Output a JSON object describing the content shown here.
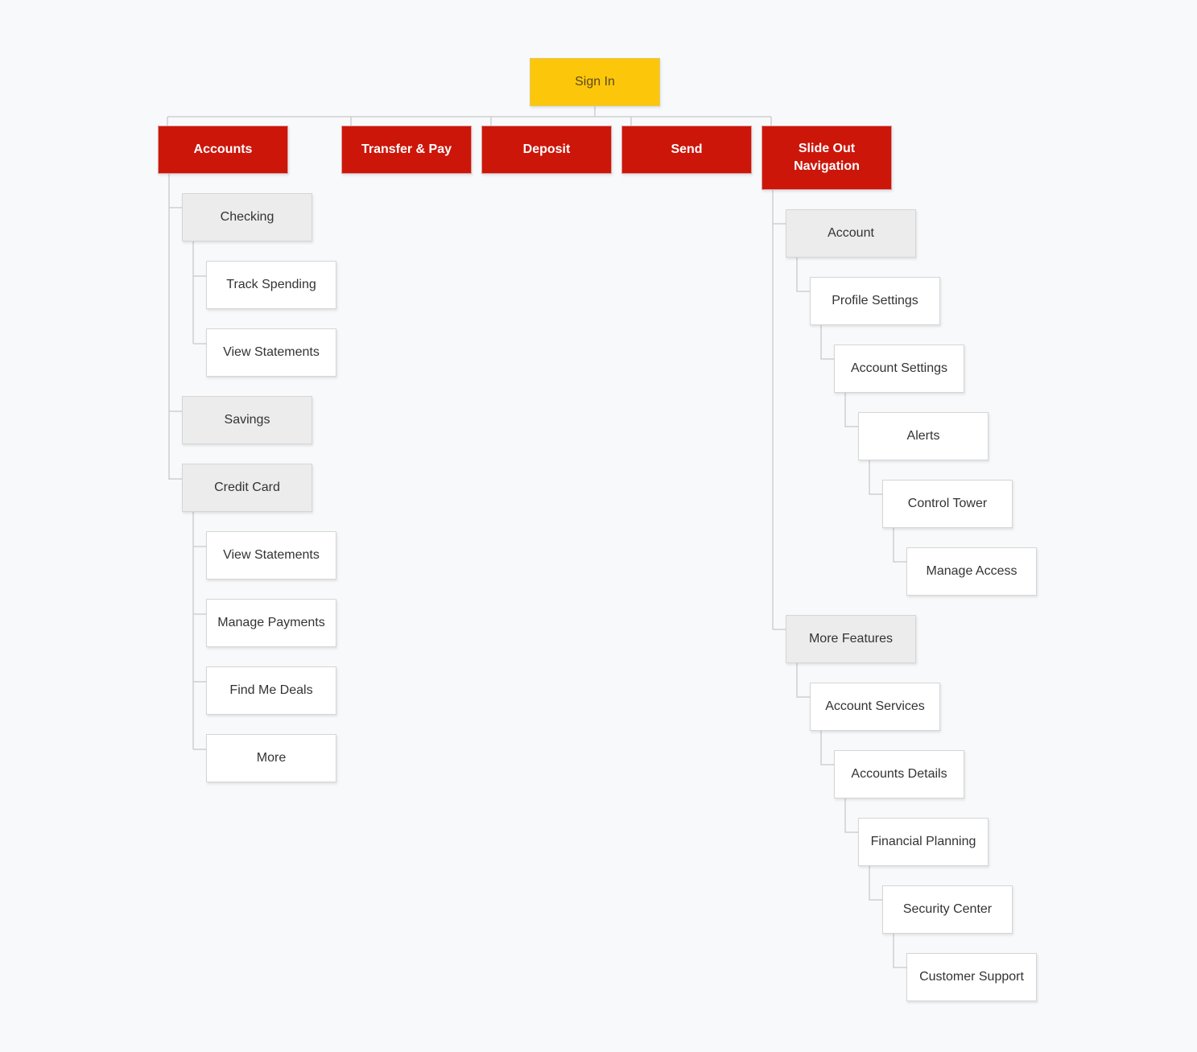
{
  "diagram": {
    "type": "sitemap",
    "colors": {
      "root": "#fcc70a",
      "primary": "#cc160a",
      "secondary": "#ececec",
      "leaf": "#ffffff",
      "connector": "#cfcfd3",
      "background": "#f8f9fb"
    },
    "root": {
      "label": "Sign In"
    },
    "primary": [
      {
        "label": "Accounts"
      },
      {
        "label": "Transfer & Pay"
      },
      {
        "label": "Deposit"
      },
      {
        "label": "Send"
      },
      {
        "label": "Slide Out Navigation"
      }
    ],
    "accounts": {
      "checking": {
        "label": "Checking",
        "children": [
          "Track Spending",
          "View Statements"
        ]
      },
      "savings": {
        "label": "Savings"
      },
      "credit_card": {
        "label": "Credit Card",
        "children": [
          "View Statements",
          "Manage Payments",
          "Find Me Deals",
          "More"
        ]
      }
    },
    "slide_out": {
      "account": {
        "label": "Account",
        "chain": [
          "Profile Settings",
          "Account Settings",
          "Alerts",
          "Control Tower",
          "Manage Access"
        ]
      },
      "more_features": {
        "label": "More Features",
        "chain": [
          "Account Services",
          "Accounts Details",
          "Financial Planning",
          "Security Center",
          "Customer Support"
        ]
      }
    }
  }
}
